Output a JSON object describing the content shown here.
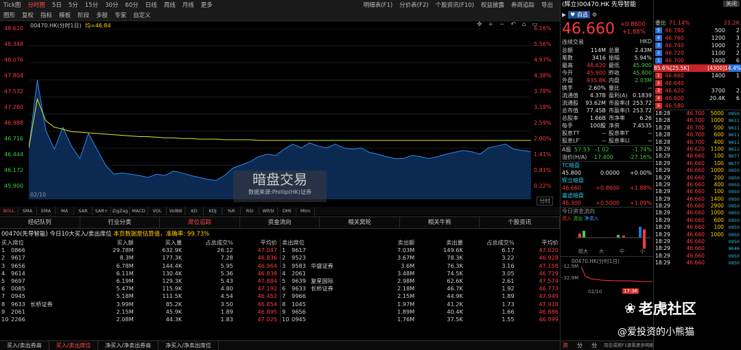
{
  "toolbar": {
    "items": [
      "Tick图",
      "分时图",
      "5日",
      "5分",
      "15分",
      "30分",
      "60分",
      "日线",
      "周线",
      "月线",
      "更多"
    ],
    "tools": [
      "图形",
      "复权",
      "指标",
      "模板",
      "阶段",
      "多股",
      "专家",
      "自定义"
    ],
    "right": [
      "明细表(F1)",
      "分价表(F2)",
      "个股资讯(F10)",
      "权益披露",
      "券商追踪",
      "导出"
    ],
    "close": "关闭"
  },
  "chart": {
    "title": "00470.HK(分时1日)",
    "avg_label": "均=46.84",
    "prices": [
      "48.620",
      "48.348",
      "48.076",
      "47.804",
      "47.532",
      "47.260",
      "46.988",
      "46.716",
      "46.444",
      "46.172",
      "45.900"
    ],
    "pcts": [
      "6.16%",
      "5.56%",
      "4.97%",
      "4.38%",
      "3.78%",
      "3.19%",
      "2.59%",
      "2.00%",
      "1.41%",
      "0.81%",
      "0.22%"
    ],
    "date": "02/10",
    "mode": "分时",
    "ctrl_icons": "✥ + − ↶ ⌂ ▭",
    "watermark": "暗盘交易",
    "watermark_sub": "数据来源:Phillip(HK)证券",
    "colors": {
      "price": "#2b8df0",
      "avg": "#e6e62a"
    }
  },
  "chart_data": {
    "type": "area",
    "series": [
      {
        "name": "price",
        "values": [
          46.72,
          47.8,
          47.0,
          46.7,
          47.05,
          46.75,
          46.55,
          46.95,
          46.7,
          46.45,
          46.3,
          46.32,
          46.3,
          46.28,
          46.25,
          46.3,
          46.28,
          46.35,
          46.32,
          46.28,
          46.25,
          46.22,
          46.2,
          46.28,
          46.4,
          46.45,
          46.5,
          46.58,
          46.62,
          46.6,
          46.7,
          46.78,
          46.72,
          46.8,
          46.75,
          46.72,
          46.78,
          46.72,
          46.7,
          46.72,
          46.65,
          46.62,
          46.58,
          46.55,
          46.55,
          46.6,
          46.58,
          46.55,
          46.58,
          46.62,
          46.65,
          46.68,
          46.66,
          46.62,
          46.72,
          46.75,
          46.78,
          46.7,
          46.68,
          46.66
        ]
      },
      {
        "name": "avg",
        "values": [
          46.72,
          47.5,
          47.15,
          47.05,
          47.02,
          46.98,
          46.97,
          46.96,
          46.95,
          46.94,
          46.93,
          46.92,
          46.91,
          46.9,
          46.9,
          46.89,
          46.88,
          46.88,
          46.87,
          46.87,
          46.86,
          46.86,
          46.86,
          46.85,
          46.85,
          46.85,
          46.85,
          46.84,
          46.84,
          46.84,
          46.84,
          46.84,
          46.84,
          46.84,
          46.84,
          46.84,
          46.84,
          46.84,
          46.84,
          46.84,
          46.84,
          46.84,
          46.84,
          46.84,
          46.84,
          46.84,
          46.84,
          46.84,
          46.84,
          46.84,
          46.84,
          46.84,
          46.84,
          46.84,
          46.84,
          46.84,
          46.84,
          46.84,
          46.84,
          46.84
        ]
      }
    ],
    "ylim": [
      45.9,
      48.62
    ]
  },
  "indicators": [
    "BOLL",
    "SMA",
    "EMA",
    "MA",
    "SAR",
    "SAR+",
    "ZigZag",
    "MACD",
    "VOL",
    "VolBB",
    "KD",
    "KDJ",
    "%R",
    "RSI",
    "WRSI",
    "DMI",
    "Mtm"
  ],
  "tabs": [
    "经纪队列",
    "行业分类",
    "席位追踪",
    "资金流向",
    "相关窝轮",
    "相关牛熊",
    "个股资讯"
  ],
  "info": {
    "prefix": "00470(先导智能)",
    "text": "今日10大买入/卖出席位",
    "highlight": "本页数据是估算值，准确率: 99.73%"
  },
  "buy": {
    "headers": [
      "买入席位",
      "买入额",
      "买入量",
      "占总成交%",
      "平均价"
    ],
    "rows": [
      [
        "1",
        "0866",
        "",
        "29.78M",
        "632.9K",
        "26.12",
        "47.047"
      ],
      [
        "2",
        "9617",
        "",
        "8.3M",
        "177.3K",
        "7.28",
        "46.836"
      ],
      [
        "3",
        "9656",
        "",
        "6.78M",
        "144.4K",
        "5.95",
        "46.964"
      ],
      [
        "4",
        "9614",
        "",
        "6.11M",
        "130.4K",
        "5.36",
        "46.838"
      ],
      [
        "5",
        "9697",
        "",
        "6.19M",
        "129.3K",
        "5.43",
        "47.884"
      ],
      [
        "6",
        "0085",
        "",
        "5.47M",
        "115.9K",
        "4.80",
        "47.192"
      ],
      [
        "7",
        "0945",
        "",
        "5.18M",
        "111.5K",
        "4.54",
        "46.452"
      ],
      [
        "8",
        "9633",
        "长桥证券",
        "3.99M",
        "85.2K",
        "3.50",
        "46.854"
      ],
      [
        "9",
        "2061",
        "",
        "2.15M",
        "45.9K",
        "1.89",
        "46.895"
      ],
      [
        "10",
        "2266",
        "",
        "2.08M",
        "44.3K",
        "1.83",
        "47.025"
      ]
    ]
  },
  "sell": {
    "headers": [
      "卖出席位",
      "卖出额",
      "卖出量",
      "占总成交%",
      "平均价"
    ],
    "rows": [
      [
        "1",
        "9617",
        "",
        "7.03M",
        "149.6K",
        "6.17",
        "47.020"
      ],
      [
        "2",
        "9523",
        "",
        "3.67M",
        "78.3K",
        "3.22",
        "46.928"
      ],
      [
        "3",
        "9583",
        "华盛证券",
        "3.6M",
        "76.3K",
        "3.16",
        "47.158"
      ],
      [
        "4",
        "2061",
        "",
        "3.48M",
        "74.5K",
        "3.05",
        "46.729"
      ],
      [
        "5",
        "9639",
        "复星国际",
        "2.98M",
        "62.6K",
        "2.61",
        "47.574"
      ],
      [
        "6",
        "9633",
        "长桥证券",
        "2.18M",
        "46.7K",
        "1.92",
        "46.773"
      ],
      [
        "7",
        "9966",
        "",
        "2.15M",
        "44.9K",
        "1.89",
        "47.949"
      ],
      [
        "8",
        "1045",
        "",
        "1.97M",
        "41.2K",
        "1.73",
        "47.918"
      ],
      [
        "9",
        "9656",
        "",
        "1.89M",
        "40.4K",
        "1.66",
        "46.886"
      ],
      [
        "10",
        "0945",
        "",
        "1.76M",
        "37.5K",
        "1.55",
        "46.999"
      ]
    ]
  },
  "bottom_tabs": [
    "买入/卖出券商",
    "买入/卖出席位",
    "净买入/净卖出券商",
    "净买入/净卖出席位"
  ],
  "quote": {
    "name": "(辉立)00470.HK",
    "cname": "先导智能",
    "btn_add": "自选",
    "price": "46.660",
    "chg": "+0.8600",
    "chg_pct": "+1.88%",
    "trade": "连续交易",
    "ccy": "HKD",
    "stats": [
      [
        "总额",
        "114M",
        "总量",
        "2.43M"
      ],
      [
        "笔数",
        "3416",
        "振幅",
        "5.94%"
      ],
      [
        "最高",
        "48.620",
        "最低",
        "45.900"
      ],
      [
        "今开",
        "45.900",
        "昨收",
        "45.800"
      ],
      [
        "外盘",
        "935.8K",
        "内盘",
        "2.03M"
      ],
      [
        "换手",
        "2.60%",
        "量比",
        "--"
      ],
      [
        "流通值",
        "4.37B",
        "盈利(A)",
        "0.1839"
      ],
      [
        "流通股",
        "93.62M",
        "市盈率(静)",
        "253.72"
      ],
      [
        "总市值",
        "77.45B",
        "市盈率(TTM)",
        "253.72"
      ],
      [
        "总股本",
        "1.66B",
        "市净率",
        "6.26"
      ],
      [
        "每手",
        "100股",
        "净资",
        "7.4535"
      ],
      [
        "股息TTM",
        "--",
        "股息率TTM",
        "--"
      ],
      [
        "股息LFY",
        "--",
        "股息率LFY",
        "--"
      ]
    ],
    "a_label": "A股",
    "a_price": "57.53",
    "a_chg": "-1.02",
    "a_pct": "-1.74%",
    "prem_label": "溢价(H/A)",
    "prem": "-17.400",
    "prem_pct": "-27.16%"
  },
  "dark": {
    "title": "TC暗盘",
    "price": "45.800",
    "chg": "0.0000",
    "pct": "+0.00%",
    "rows": [
      {
        "name": "辉立暗盘",
        "price": "46.660",
        "chg": "+0.8600",
        "pct": "+1.88%"
      },
      {
        "name": "富途暗盘",
        "price": "46.300",
        "chg": "+0.5000",
        "pct": "+1.09%"
      }
    ]
  },
  "flow": {
    "title": "今日资金流向",
    "legend": [
      "流入",
      "流出",
      "净流入"
    ],
    "ticks": [
      "40M",
      "20M",
      "0",
      "-20M"
    ],
    "cats": [
      "超大",
      "大",
      "中",
      "小"
    ],
    "mini_title": "00470.HK(分时1日)",
    "mini_ticks": [
      "-12.9M",
      "-32.9M"
    ],
    "mini_date": "02/10",
    "mini_time": "17:36"
  },
  "book": {
    "ratio_label": "委比",
    "ratio": "71.14%",
    "ratio_vol": "21.2K",
    "asks": [
      [
        "5",
        "46.780",
        "500",
        "2"
      ],
      [
        "4",
        "46.760",
        "1200",
        "3"
      ],
      [
        "3",
        "46.740",
        "1000",
        "2"
      ],
      [
        "2",
        "46.720",
        "1100",
        "2"
      ],
      [
        "1",
        "46.700",
        "1400",
        "6"
      ]
    ],
    "bar_left": "85.6%[25.5K]",
    "bar_right": "14.4%[4300]",
    "bids": [
      [
        "1",
        "46.660",
        "1400",
        "1"
      ],
      [
        "2",
        "46.640",
        "",
        ""
      ],
      [
        "3",
        "46.620",
        "3700",
        "2"
      ],
      [
        "4",
        "46.600",
        "20.4K",
        "6"
      ],
      [
        "5",
        "46.580",
        "",
        ""
      ]
    ]
  },
  "ticks": [
    [
      "18:28",
      "46.700",
      "5000",
      "0950"
    ],
    [
      "18:28",
      "46.700",
      "1000",
      "9611"
    ],
    [
      "18:28",
      "46.700",
      "500",
      "9611"
    ],
    [
      "18:28",
      "46.700",
      "600",
      "9611"
    ],
    [
      "18:28",
      "46.700",
      "400",
      "9611"
    ],
    [
      "18:29",
      "46.620",
      "1100",
      "9611"
    ],
    [
      "18:29",
      "46.660",
      "100",
      "9677"
    ],
    [
      "18:29",
      "46.660",
      "100",
      "9677"
    ],
    [
      "18:29",
      "46.660",
      "1000",
      "0950"
    ],
    [
      "18:29",
      "46.660",
      "200",
      "0950"
    ],
    [
      "18:29",
      "46.660",
      "400",
      "0950"
    ],
    [
      "18:29",
      "46.660",
      "100",
      "0950"
    ],
    [
      "18:29",
      "46.660",
      "1400",
      "0950"
    ],
    [
      "18:29",
      "46.660",
      "2900",
      "0950"
    ],
    [
      "18:29",
      "46.660",
      "1000",
      "0950"
    ],
    [
      "18:29",
      "46.660",
      "600",
      "0950"
    ],
    [
      "18:29",
      "46.660",
      "100",
      "0950"
    ],
    [
      "18:29",
      "46.660",
      "1000",
      "0950"
    ],
    [
      "18:29",
      "46.660",
      "",
      "0950"
    ],
    [
      "18:29",
      "46.660",
      "",
      "9646"
    ],
    [
      "18:29",
      "46.660",
      "",
      "0950"
    ],
    [
      "18:29",
      "46.660",
      "",
      "0950"
    ]
  ],
  "side_tabs": [
    "资金",
    "分价",
    "分时"
  ],
  "side_footer": "双击或按F1查看更多明细",
  "overlay": {
    "brand": "老虎社区",
    "author": "@爱投资的小熊猫"
  }
}
